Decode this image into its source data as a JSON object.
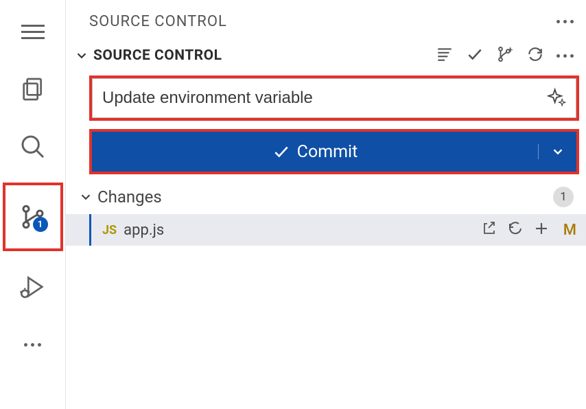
{
  "activityBar": {
    "sourceControlBadge": "1"
  },
  "titleBar": {
    "title": "SOURCE CONTROL"
  },
  "section": {
    "title": "SOURCE CONTROL"
  },
  "commit": {
    "message": "Update environment variable",
    "buttonLabel": "Commit"
  },
  "changes": {
    "label": "Changes",
    "count": "1",
    "files": [
      {
        "icon": "JS",
        "name": "app.js",
        "status": "M"
      }
    ]
  }
}
